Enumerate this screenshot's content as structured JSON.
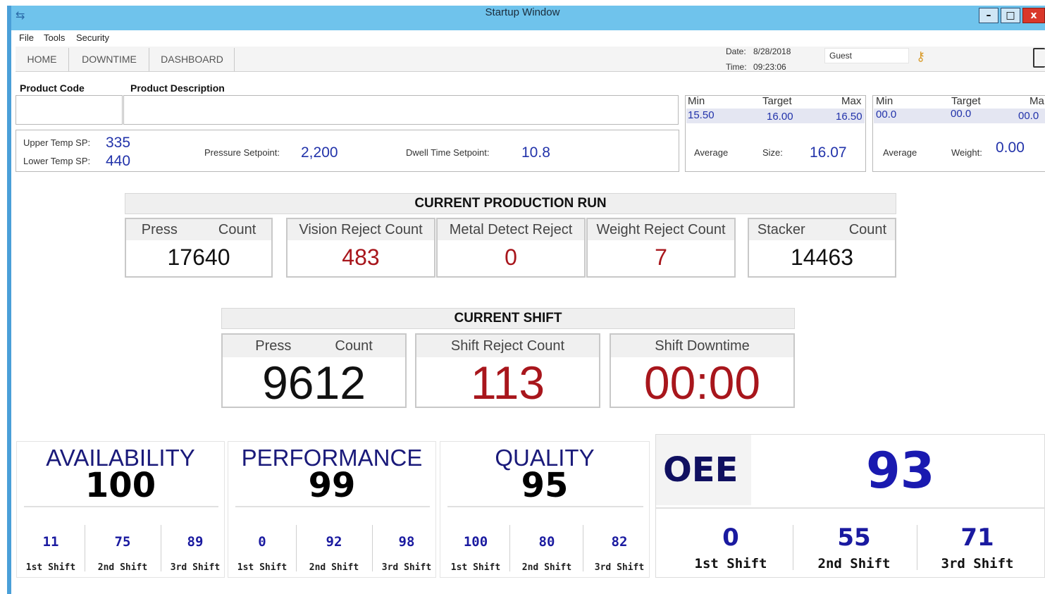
{
  "window": {
    "title": "Startup Window",
    "min": "–",
    "max": "□",
    "close": "x",
    "app_icon": "plug-icon"
  },
  "menu": [
    "File",
    "Tools",
    "Security"
  ],
  "nav": {
    "tabs": [
      "HOME",
      "DOWNTIME",
      "DASHBOARD"
    ]
  },
  "header": {
    "date_label": "Date:",
    "date_value": "8/28/2018",
    "time_label": "Time:",
    "time_value": "09:23:06",
    "user": "Guest",
    "key_icon": "key-icon",
    "logout_icon": "logout-icon"
  },
  "product": {
    "code_label": "Product Code",
    "desc_label": "Product Description"
  },
  "setpoints": {
    "upper_label": "Upper Temp SP:",
    "upper_value": "335",
    "lower_label": "Lower Temp SP:",
    "lower_value": "440",
    "pressure_label": "Pressure Setpoint:",
    "pressure_value": "2,200",
    "dwell_label": "Dwell Time Setpoint:",
    "dwell_value": "10.8"
  },
  "size_stats": {
    "min_label": "Min",
    "target_label": "Target",
    "max_label": "Max",
    "min": "15.50",
    "target": "16.00",
    "max": "16.50",
    "avg_label": "Average",
    "avg_label_2": "Size:",
    "avg_value": "16.07"
  },
  "weight_stats": {
    "min_label": "Min",
    "target_label": "Target",
    "max_label": "Ma",
    "min": "00.0",
    "target": "00.0",
    "max": "00.0",
    "avg_label": "Average",
    "avg_label_2": "Weight:",
    "avg_value": "0.00"
  },
  "production_run": {
    "title": "CURRENT PRODUCTION RUN",
    "cards": [
      {
        "label": "Press",
        "label_2": "Count",
        "value": "17640"
      },
      {
        "label": "Vision Reject Count",
        "value": "483"
      },
      {
        "label": "Metal Detect Reject",
        "value": "0"
      },
      {
        "label": "Weight Reject Count",
        "value": "7"
      },
      {
        "label": "Stacker",
        "label_2": "Count",
        "value": "14463"
      }
    ]
  },
  "current_shift": {
    "title": "CURRENT SHIFT",
    "cards": [
      {
        "label": "Press",
        "label_2": "Count",
        "value": "9612"
      },
      {
        "label": "Shift Reject Count",
        "value": "113"
      },
      {
        "label": "Shift Downtime",
        "value": "00:00"
      }
    ]
  },
  "kpis": [
    {
      "title": "AVAILABILITY",
      "value": "100",
      "shifts": [
        {
          "value": "11",
          "label": "1st Shift"
        },
        {
          "value": "75",
          "label": "2nd Shift"
        },
        {
          "value": "89",
          "label": "3rd Shift"
        }
      ]
    },
    {
      "title": "PERFORMANCE",
      "value": "99",
      "shifts": [
        {
          "value": "0",
          "label": "1st Shift"
        },
        {
          "value": "92",
          "label": "2nd Shift"
        },
        {
          "value": "98",
          "label": "3rd Shift"
        }
      ]
    },
    {
      "title": "QUALITY",
      "value": "95",
      "shifts": [
        {
          "value": "100",
          "label": "1st Shift"
        },
        {
          "value": "80",
          "label": "2nd Shift"
        },
        {
          "value": "82",
          "label": "3rd Shift"
        }
      ]
    }
  ],
  "oee": {
    "title": "OEE",
    "value": "93",
    "shifts": [
      {
        "value": "0",
        "label": "1st Shift"
      },
      {
        "value": "55",
        "label": "2nd Shift"
      },
      {
        "value": "71",
        "label": "3rd Shift"
      }
    ]
  },
  "colors": {
    "titlebar": "#6fc3ec",
    "value_blue": "#2233aa",
    "value_red": "#a8161c",
    "kpi_title": "#1a1a7a"
  }
}
